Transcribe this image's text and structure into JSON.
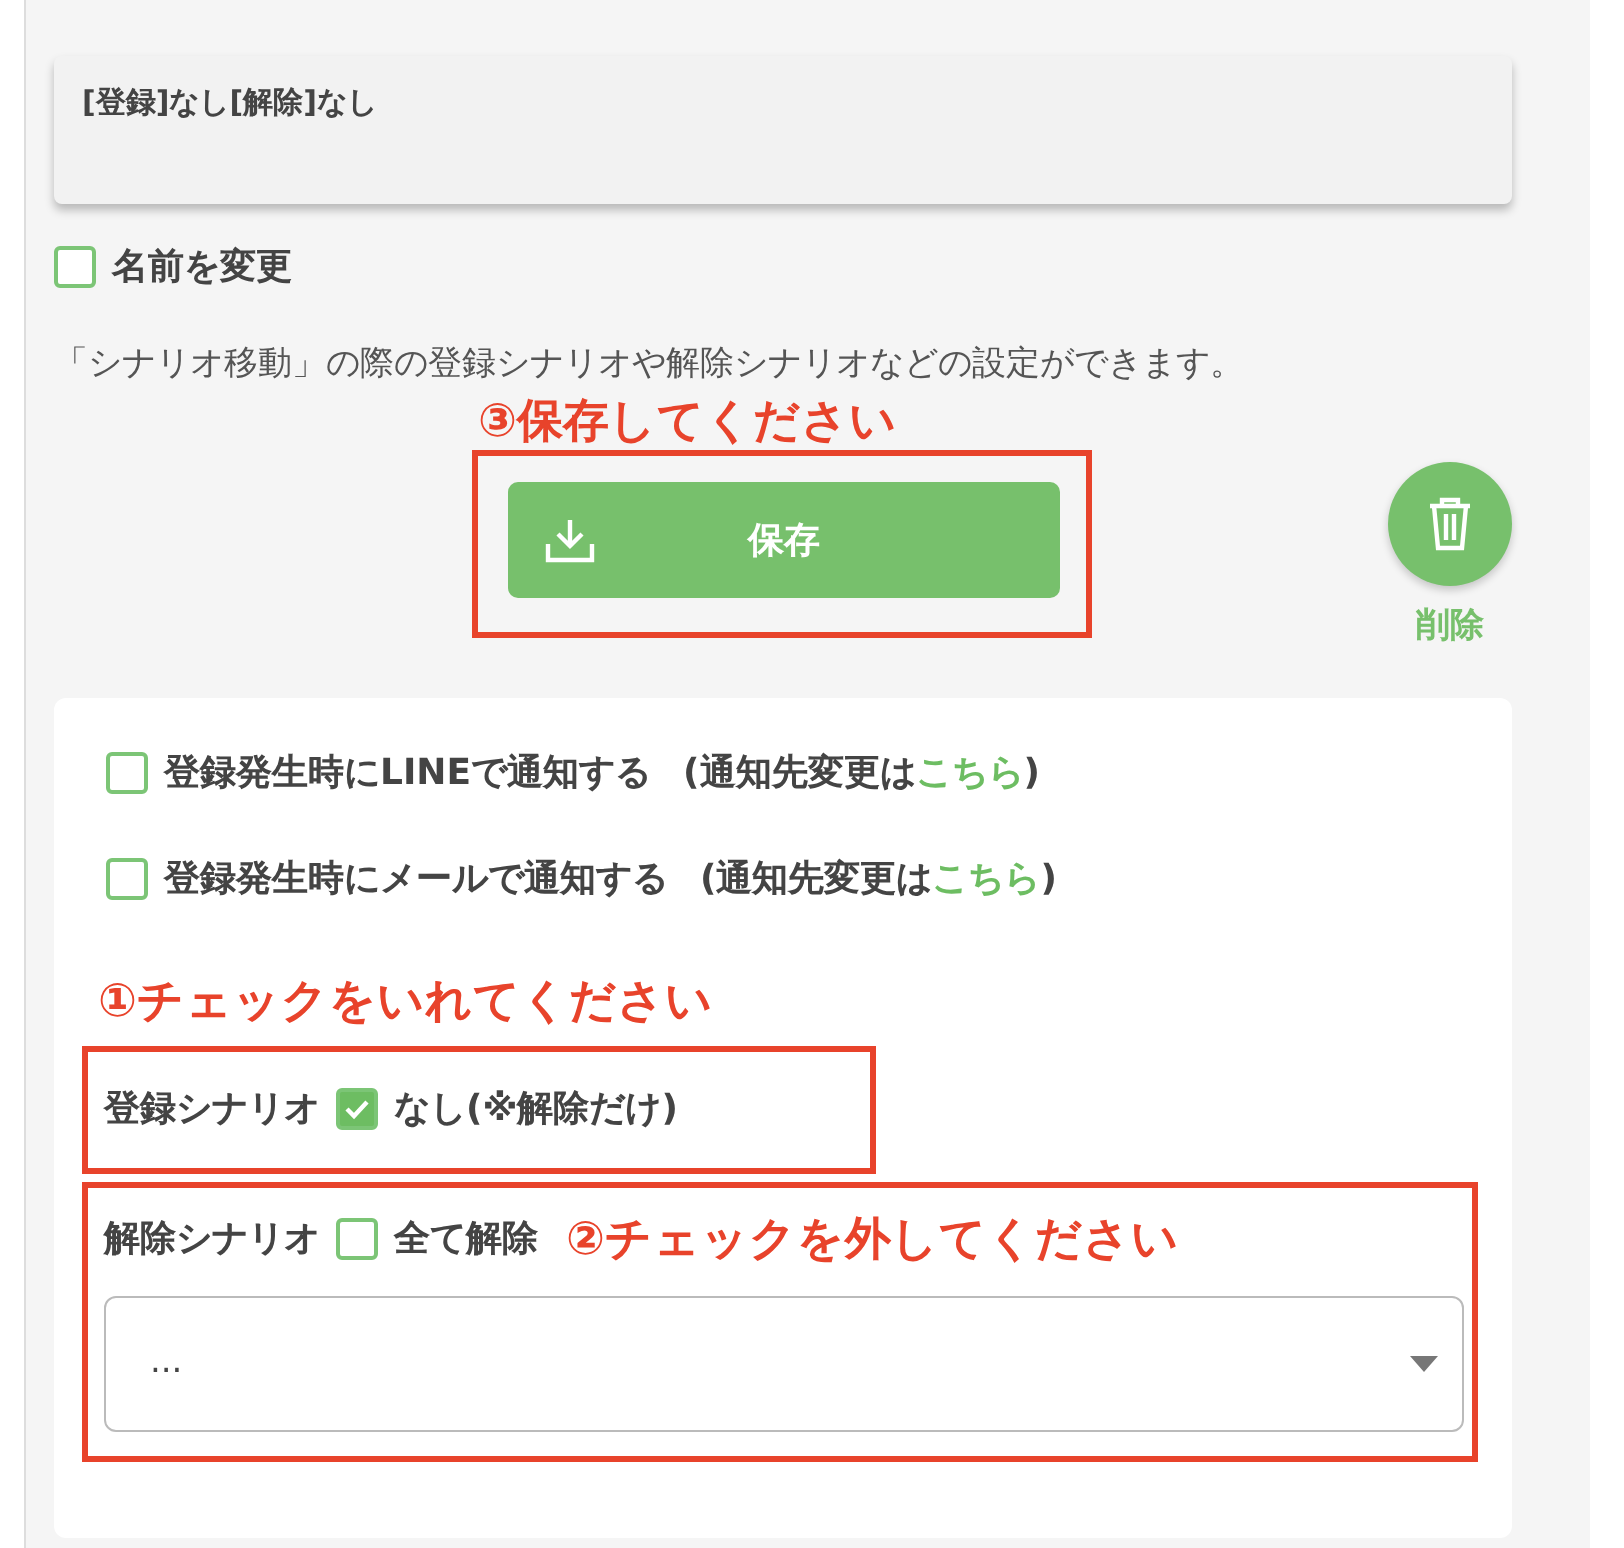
{
  "summary": {
    "text": "[登録]なし[解除]なし"
  },
  "rename": {
    "label": "名前を変更",
    "checked": false
  },
  "description": "「シナリオ移動」の際の登録シナリオや解除シナリオなどの設定ができます。",
  "save": {
    "label": "保存",
    "callout": "③保存してください",
    "highlighted": true
  },
  "delete": {
    "label": "削除"
  },
  "notifications": [
    {
      "label": "登録発生時にLINEで通知する",
      "note": "(通知先変更は",
      "link": "こちら",
      "close": ")",
      "checked": false
    },
    {
      "label": "登録発生時にメールで通知する",
      "note": "(通知先変更は",
      "link": "こちら",
      "close": ")",
      "checked": false
    }
  ],
  "register_scenario": {
    "callout": "①チェックをいれてください",
    "highlighted": true,
    "label": "登録シナリオ",
    "option": "なし(※解除だけ)",
    "checked": true
  },
  "release_scenario": {
    "callout": "②チェックを外してください",
    "highlighted": true,
    "label": "解除シナリオ",
    "option": "全て解除",
    "checked": false,
    "select_value": "..."
  }
}
